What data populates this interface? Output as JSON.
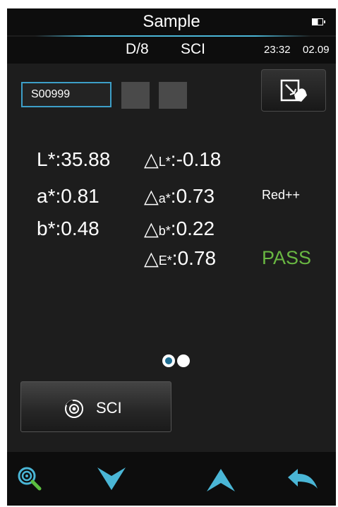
{
  "header": {
    "title": "Sample",
    "battery_icon": "battery-icon"
  },
  "subheader": {
    "geometry": "D/8",
    "mode": "SCI",
    "time": "23:32",
    "date": "02.09"
  },
  "sample": {
    "name": "S00999"
  },
  "measurements": {
    "L": {
      "label": "L*:",
      "value": "35.88"
    },
    "a": {
      "label": "a*:",
      "value": "0.81"
    },
    "b": {
      "label": "b*:",
      "value": "0.48"
    }
  },
  "differences": {
    "dL": {
      "tri": "△",
      "label": "L*",
      "sep": ":",
      "value": "-0.18"
    },
    "da": {
      "tri": "△",
      "label": "a*",
      "sep": ":",
      "value": "0.73"
    },
    "db": {
      "tri": "△",
      "label": "b*",
      "sep": ":",
      "value": "0.22"
    },
    "dE": {
      "tri": "△",
      "label": "E*",
      "sep": ":",
      "value": "0.78"
    }
  },
  "status": {
    "color_shift": "Red++",
    "result": "PASS",
    "result_color": "#69b742"
  },
  "pager": {
    "current": 1,
    "total": 2
  },
  "mode_button": {
    "label": "SCI",
    "icon": "lens-icon"
  },
  "toolbar": {
    "icons": [
      "search-icon",
      "arrow-down-icon",
      "arrow-up-icon",
      "back-icon"
    ]
  },
  "colors": {
    "accent": "#4ab6d6",
    "sample_border": "#3d9fc8",
    "background": "#1d1d1d"
  }
}
